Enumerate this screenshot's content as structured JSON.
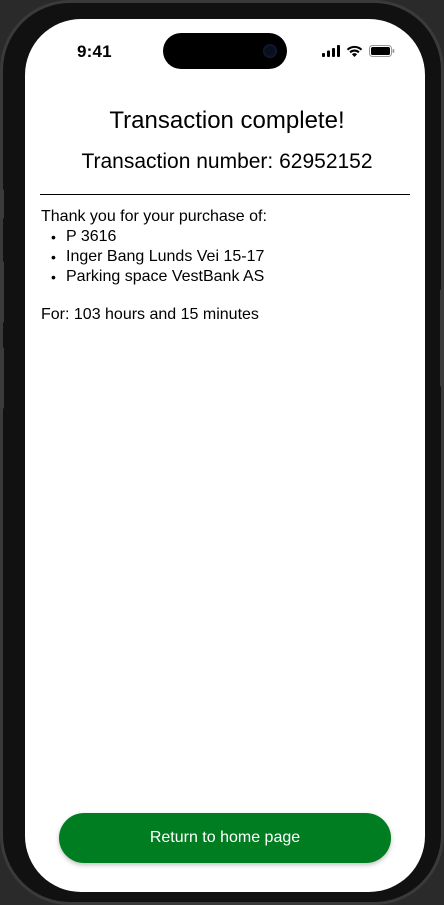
{
  "status_bar": {
    "time": "9:41",
    "icons": [
      "cellular-signal-icon",
      "wifi-icon",
      "battery-icon"
    ]
  },
  "header": {
    "title": "Transaction complete!",
    "transaction_label": "Transaction number: ",
    "transaction_number": "62952152"
  },
  "purchase": {
    "intro": "Thank you for your purchase of:",
    "items": [
      "P 3616",
      "Inger Bang Lunds Vei 15-17",
      "Parking space VestBank AS"
    ]
  },
  "duration": {
    "label": "For: ",
    "value": "103 hours and 15 minutes"
  },
  "actions": {
    "return_home_label": "Return to home page"
  },
  "colors": {
    "primary_button": "#007d20",
    "button_text": "#ffffff",
    "background": "#ffffff",
    "text": "#000000"
  }
}
